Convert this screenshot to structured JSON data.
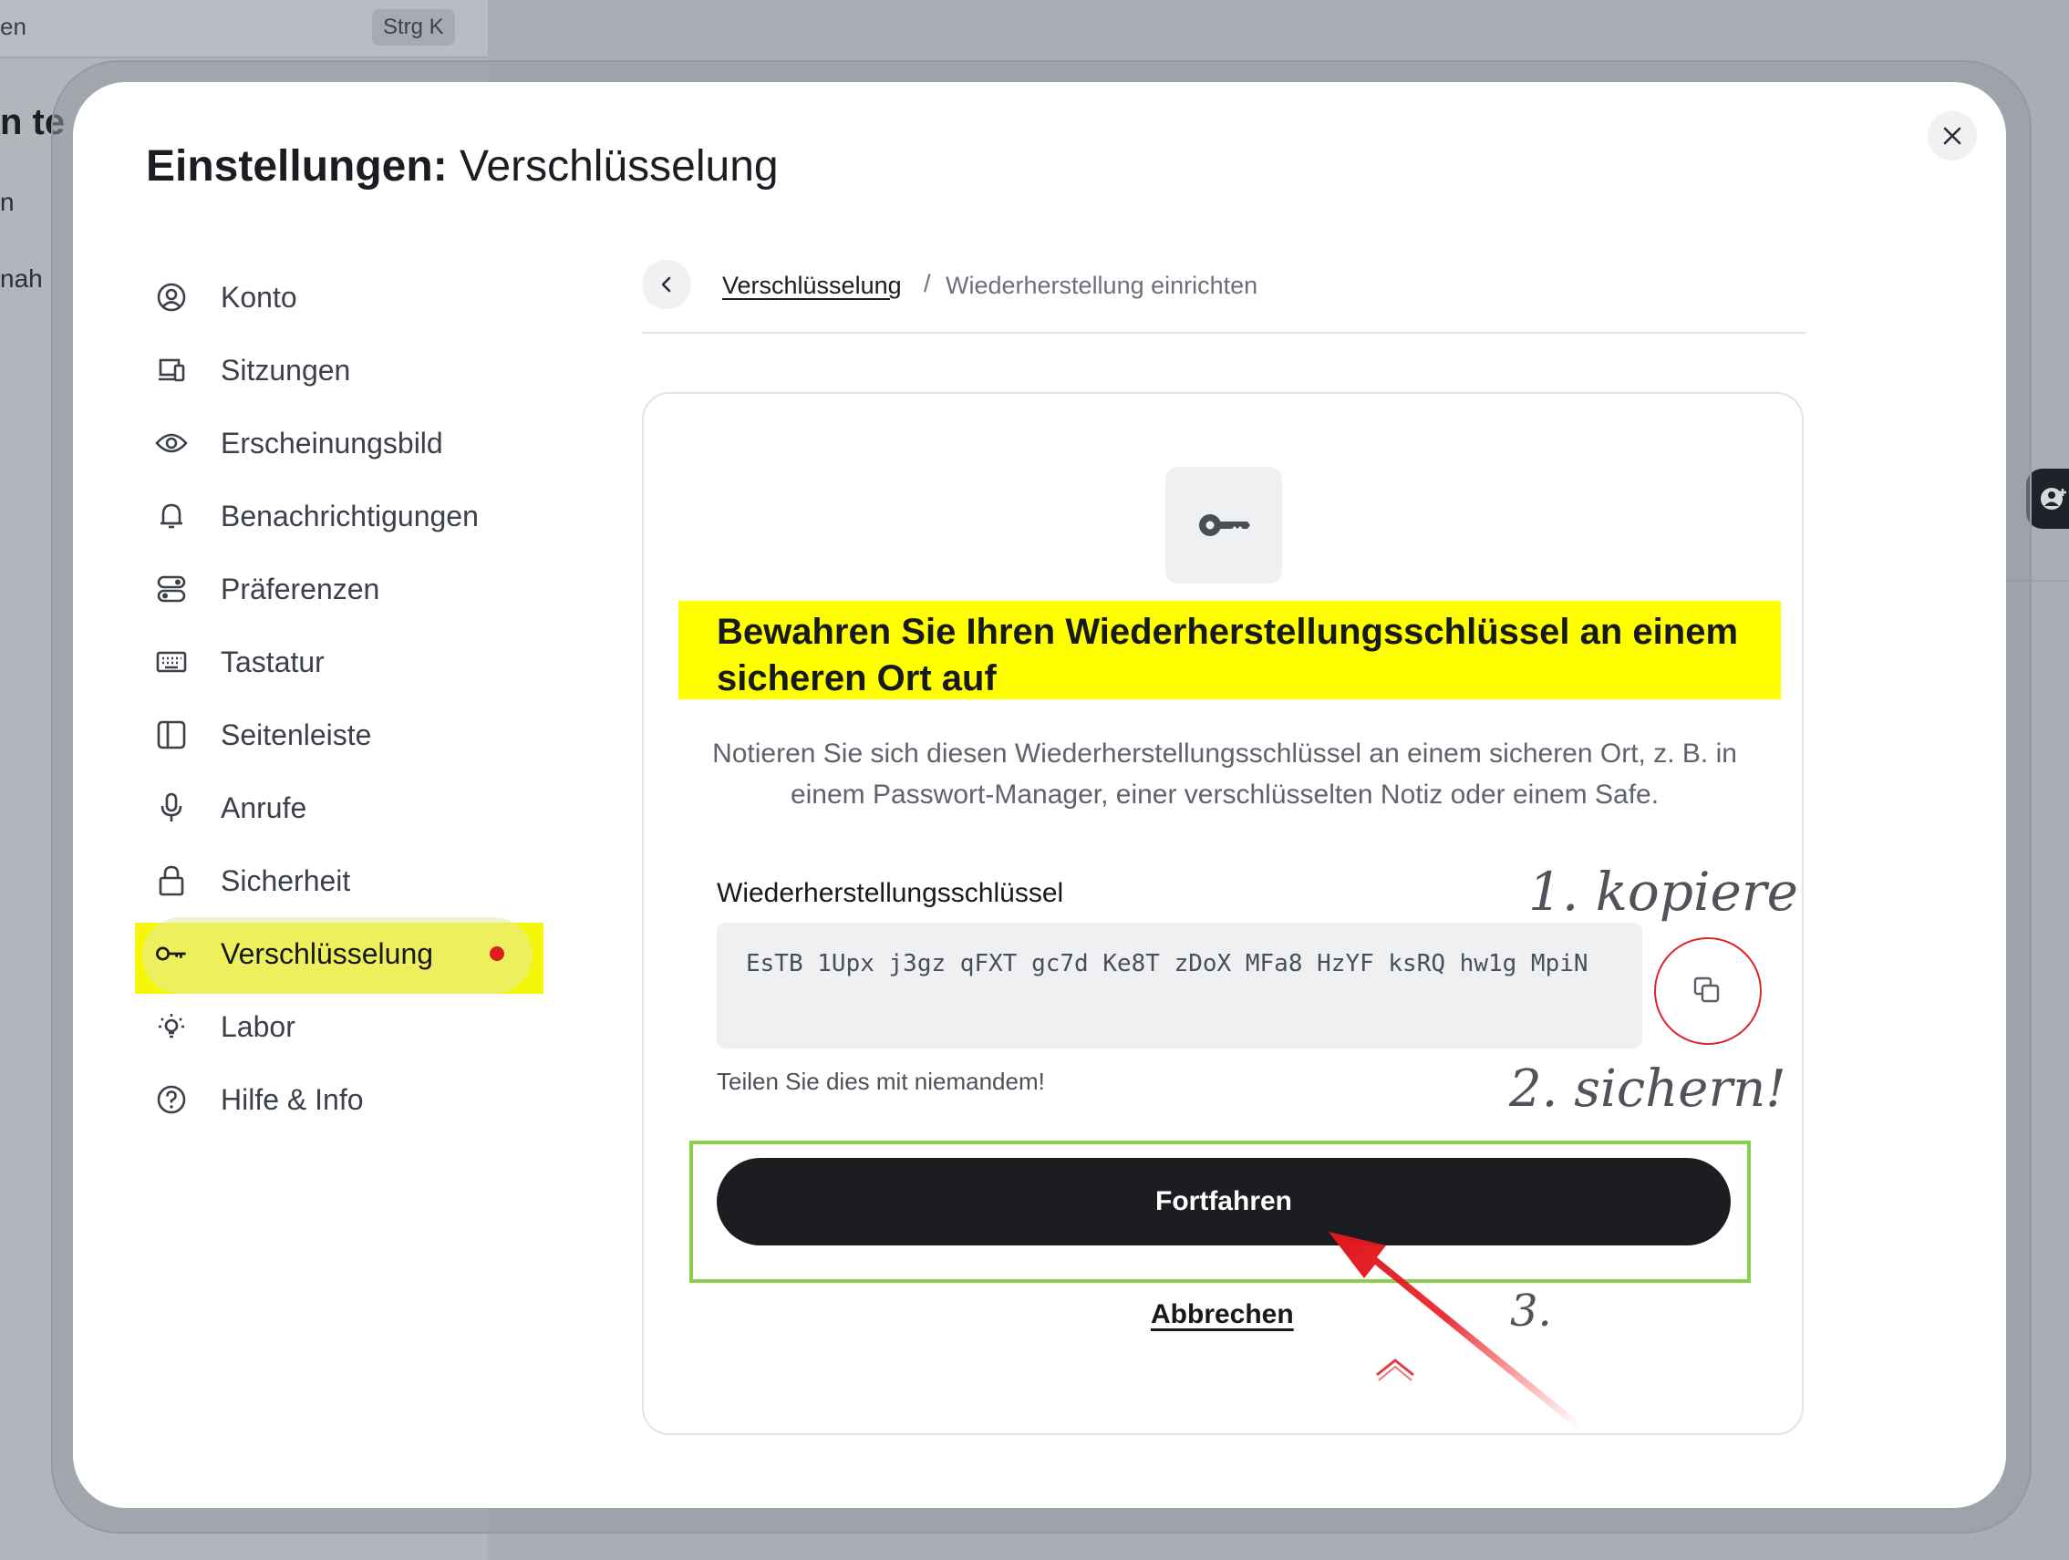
{
  "background": {
    "search_text": "en",
    "search_shortcut": "Strg K",
    "heading_fragment": "n te",
    "line1_fragment": "n",
    "line2_fragment": "nah"
  },
  "dialog": {
    "title_bold": "Einstellungen:",
    "title_rest": "Verschlüsselung",
    "close_icon": "close-icon"
  },
  "sidebar": {
    "items": [
      {
        "label": "Konto",
        "icon": "account-circle-icon"
      },
      {
        "label": "Sitzungen",
        "icon": "devices-icon"
      },
      {
        "label": "Erscheinungsbild",
        "icon": "eye-icon"
      },
      {
        "label": "Benachrichtigungen",
        "icon": "bell-icon"
      },
      {
        "label": "Präferenzen",
        "icon": "toggles-icon"
      },
      {
        "label": "Tastatur",
        "icon": "keyboard-icon"
      },
      {
        "label": "Seitenleiste",
        "icon": "sidebar-icon"
      },
      {
        "label": "Anrufe",
        "icon": "microphone-icon"
      },
      {
        "label": "Sicherheit",
        "icon": "lock-icon"
      },
      {
        "label": "Verschlüsselung",
        "icon": "key-icon",
        "active": true,
        "badge_color": "#d81e1e"
      },
      {
        "label": "Labor",
        "icon": "lightbulb-icon"
      },
      {
        "label": "Hilfe & Info",
        "icon": "help-circle-icon"
      }
    ]
  },
  "breadcrumb": {
    "link": "Verschlüsselung",
    "separator": "/",
    "current": "Wiederherstellung einrichten"
  },
  "card": {
    "headline": "Bewahren Sie Ihren Wiederherstellungsschlüssel an einem sicheren Ort auf",
    "description": "Notieren Sie sich diesen Wiederherstellungsschlüssel an einem sicheren Ort, z. B. in einem Passwort-Manager, einer verschlüsselten Notiz oder einem Safe.",
    "field_label": "Wiederherstellungsschlüssel",
    "recovery_key": "EsTB 1Upx j3gz qFXT gc7d Ke8T zDoX MFa8 HzYF ksRQ hw1g MpiN",
    "hint": "Teilen Sie dies mit niemandem!",
    "continue_label": "Fortfahren",
    "cancel_label": "Abbrechen"
  },
  "annotations": {
    "step1": "1. kopiere",
    "step2": "2. sichern!",
    "step3": "3."
  },
  "colors": {
    "highlight_yellow": "#ffff00",
    "annotation_green": "#8ad04b",
    "annotation_red": "#d9272c",
    "primary_button": "#1b1d21"
  }
}
